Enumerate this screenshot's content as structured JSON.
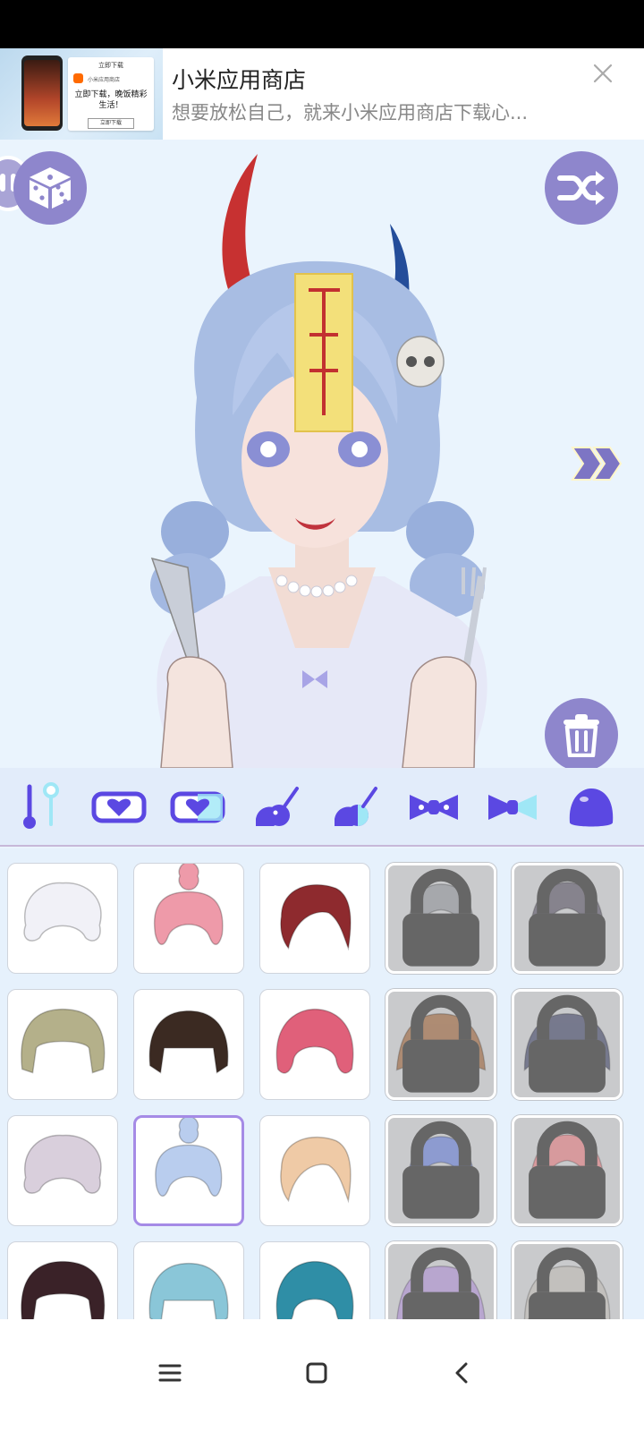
{
  "ad": {
    "title": "小米应用商店",
    "description": "想要放松自己，就来小米应用商店下载心...",
    "thumbnail": {
      "header": "立即下载",
      "store_name": "小米应用商店",
      "tagline": "立即下载，晚饭精彩生活！",
      "button": "立即下载"
    }
  },
  "preview": {
    "left_button_icon": "dice-icon",
    "right_button_icon": "shuffle-icon",
    "next_icon": "double-chevron-right-icon",
    "delete_icon": "trash-icon",
    "accent_color": "#8e86cc"
  },
  "categories": [
    {
      "name": "slider-icon",
      "selected": true
    },
    {
      "name": "heart-bar-icon"
    },
    {
      "name": "heart-bar-dual-icon"
    },
    {
      "name": "bomb-icon"
    },
    {
      "name": "bomb-dual-icon"
    },
    {
      "name": "bow-icon"
    },
    {
      "name": "bow-dual-icon"
    },
    {
      "name": "blob-icon"
    }
  ],
  "hair_items": [
    {
      "color": "#f1f1f7",
      "locked": false
    },
    {
      "color": "#ee9aa9",
      "locked": false
    },
    {
      "color": "#8e2a2e",
      "locked": false
    },
    {
      "color": "#9a9ca2",
      "locked": true
    },
    {
      "color": "#6f6b78",
      "locked": true
    },
    {
      "color": "#b4b08a",
      "locked": false
    },
    {
      "color": "#3b2a22",
      "locked": false
    },
    {
      "color": "#e0607a",
      "locked": false
    },
    {
      "color": "#a47756",
      "locked": true
    },
    {
      "color": "#5b5e78",
      "locked": true
    },
    {
      "color": "#d9cfdc",
      "locked": false
    },
    {
      "color": "#b9cdee",
      "locked": false,
      "selected": true
    },
    {
      "color": "#efcaa6",
      "locked": false
    },
    {
      "color": "#7a8cd2",
      "locked": true
    },
    {
      "color": "#dc8a8e",
      "locked": true
    },
    {
      "color": "#3a2228",
      "locked": false
    },
    {
      "color": "#8ac6d8",
      "locked": false
    },
    {
      "color": "#2f8ea6",
      "locked": false
    },
    {
      "color": "#b39ad0",
      "locked": true
    },
    {
      "color": "#c0bdb8",
      "locked": true
    }
  ],
  "nav": [
    "menu-icon",
    "home-square-icon",
    "back-chevron-icon"
  ]
}
